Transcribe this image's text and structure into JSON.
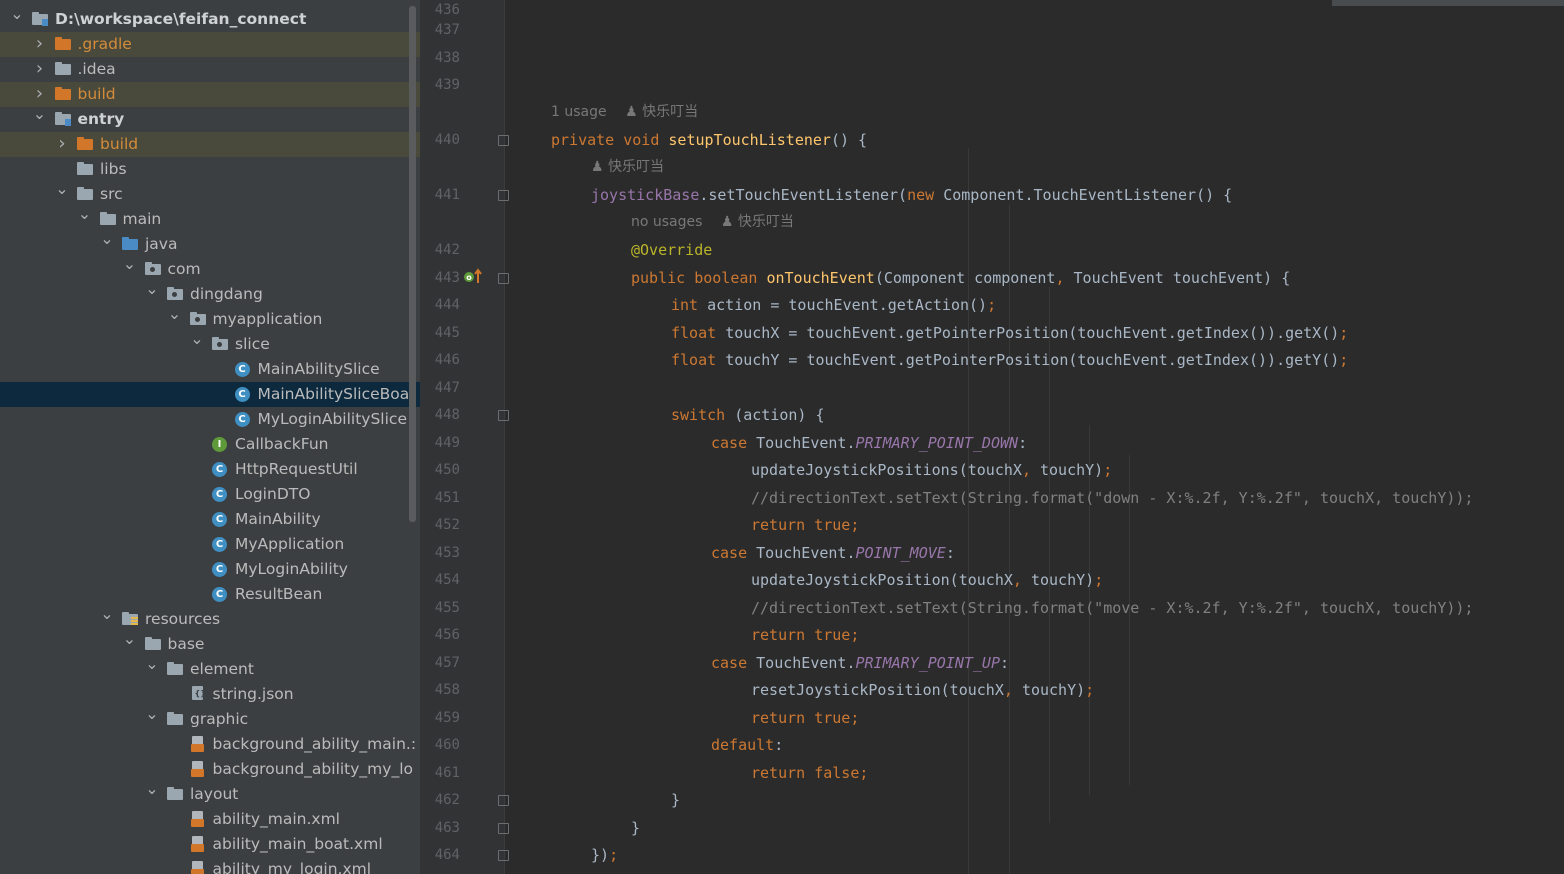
{
  "project_tree": [
    {
      "depth": 0,
      "arrow": "down",
      "icon": "module-folder",
      "label": "D:\\workspace\\feifan_connect",
      "style": "bold"
    },
    {
      "depth": 1,
      "arrow": "right",
      "icon": "orange-folder",
      "label": ".gradle",
      "style": "excluded"
    },
    {
      "depth": 1,
      "arrow": "right",
      "icon": "gray-folder",
      "label": ".idea",
      "style": "normal"
    },
    {
      "depth": 1,
      "arrow": "right",
      "icon": "orange-folder",
      "label": "build",
      "style": "excluded"
    },
    {
      "depth": 1,
      "arrow": "down",
      "icon": "module-folder",
      "label": "entry",
      "style": "bold"
    },
    {
      "depth": 2,
      "arrow": "right",
      "icon": "orange-folder",
      "label": "build",
      "style": "excluded"
    },
    {
      "depth": 2,
      "arrow": "none",
      "icon": "gray-folder",
      "label": "libs",
      "style": "normal"
    },
    {
      "depth": 2,
      "arrow": "down",
      "icon": "gray-folder",
      "label": "src",
      "style": "normal"
    },
    {
      "depth": 3,
      "arrow": "down",
      "icon": "gray-folder",
      "label": "main",
      "style": "normal"
    },
    {
      "depth": 4,
      "arrow": "down",
      "icon": "blue-folder",
      "label": "java",
      "style": "normal"
    },
    {
      "depth": 5,
      "arrow": "down",
      "icon": "package-folder",
      "label": "com",
      "style": "normal"
    },
    {
      "depth": 6,
      "arrow": "down",
      "icon": "package-folder",
      "label": "dingdang",
      "style": "normal"
    },
    {
      "depth": 7,
      "arrow": "down",
      "icon": "package-folder",
      "label": "myapplication",
      "style": "normal"
    },
    {
      "depth": 8,
      "arrow": "down",
      "icon": "package-folder",
      "label": "slice",
      "style": "normal"
    },
    {
      "depth": 9,
      "arrow": "none",
      "icon": "class",
      "label": "MainAbilitySlice",
      "style": "normal"
    },
    {
      "depth": 9,
      "arrow": "none",
      "icon": "class",
      "label": "MainAbilitySliceBoa",
      "style": "selected"
    },
    {
      "depth": 9,
      "arrow": "none",
      "icon": "class",
      "label": "MyLoginAbilitySlice",
      "style": "normal"
    },
    {
      "depth": 8,
      "arrow": "none",
      "icon": "interface",
      "label": "CallbackFun",
      "style": "normal"
    },
    {
      "depth": 8,
      "arrow": "none",
      "icon": "class",
      "label": "HttpRequestUtil",
      "style": "normal"
    },
    {
      "depth": 8,
      "arrow": "none",
      "icon": "class",
      "label": "LoginDTO",
      "style": "normal"
    },
    {
      "depth": 8,
      "arrow": "none",
      "icon": "class",
      "label": "MainAbility",
      "style": "normal"
    },
    {
      "depth": 8,
      "arrow": "none",
      "icon": "class",
      "label": "MyApplication",
      "style": "normal"
    },
    {
      "depth": 8,
      "arrow": "none",
      "icon": "class",
      "label": "MyLoginAbility",
      "style": "normal"
    },
    {
      "depth": 8,
      "arrow": "none",
      "icon": "class",
      "label": "ResultBean",
      "style": "normal"
    },
    {
      "depth": 4,
      "arrow": "down",
      "icon": "resources-folder",
      "label": "resources",
      "style": "normal"
    },
    {
      "depth": 5,
      "arrow": "down",
      "icon": "gray-folder",
      "label": "base",
      "style": "normal"
    },
    {
      "depth": 6,
      "arrow": "down",
      "icon": "gray-folder",
      "label": "element",
      "style": "normal"
    },
    {
      "depth": 7,
      "arrow": "none",
      "icon": "json-file",
      "label": "string.json",
      "style": "normal"
    },
    {
      "depth": 6,
      "arrow": "down",
      "icon": "gray-folder",
      "label": "graphic",
      "style": "normal"
    },
    {
      "depth": 7,
      "arrow": "none",
      "icon": "xml-file",
      "label": "background_ability_main.:",
      "style": "normal"
    },
    {
      "depth": 7,
      "arrow": "none",
      "icon": "xml-file",
      "label": "background_ability_my_lo",
      "style": "normal"
    },
    {
      "depth": 6,
      "arrow": "down",
      "icon": "gray-folder",
      "label": "layout",
      "style": "normal"
    },
    {
      "depth": 7,
      "arrow": "none",
      "icon": "xml-file",
      "label": "ability_main.xml",
      "style": "normal"
    },
    {
      "depth": 7,
      "arrow": "none",
      "icon": "xml-file",
      "label": "ability_main_boat.xml",
      "style": "normal"
    },
    {
      "depth": 7,
      "arrow": "none",
      "icon": "xml-file",
      "label": "ability_my_login.xml",
      "style": "normal"
    }
  ],
  "editor": {
    "hints": {
      "method_usage": "1 usage",
      "method_author": "快乐叮当",
      "listener_author": "快乐叮当",
      "override_usage": "no usages",
      "override_author": "快乐叮当"
    },
    "lines": [
      {
        "no": "436",
        "tokens": []
      },
      {
        "no": "437",
        "tokens": []
      },
      {
        "no": "438",
        "tokens": []
      },
      {
        "no": "439",
        "tokens": []
      },
      {
        "no": "440",
        "tokens": [
          [
            "kw",
            "private void "
          ],
          [
            "fn",
            "setupTouchListener"
          ],
          [
            "",
            "() {"
          ]
        ]
      },
      {
        "no": "441",
        "tokens": [
          [
            "field",
            "joystickBase"
          ],
          [
            "",
            ".setTouchEventListener("
          ],
          [
            "kw",
            "new "
          ],
          [
            "",
            "Component.TouchEventListener() {"
          ]
        ]
      },
      {
        "no": "442",
        "tokens": [
          [
            "an",
            "@Override"
          ]
        ]
      },
      {
        "no": "443",
        "tokens": [
          [
            "kw",
            "public boolean "
          ],
          [
            "fn",
            "onTouchEvent"
          ],
          [
            "",
            "(Component component"
          ],
          [
            "kw",
            ", "
          ],
          [
            "",
            "TouchEvent touchEvent) {"
          ]
        ]
      },
      {
        "no": "444",
        "tokens": [
          [
            "kw",
            "int "
          ],
          [
            "",
            "action = touchEvent.getAction()"
          ],
          [
            "kw",
            ";"
          ]
        ]
      },
      {
        "no": "445",
        "tokens": [
          [
            "kw",
            "float "
          ],
          [
            "",
            "touchX = touchEvent.getPointerPosition(touchEvent.getIndex()).getX()"
          ],
          [
            "kw",
            ";"
          ]
        ]
      },
      {
        "no": "446",
        "tokens": [
          [
            "kw",
            "float "
          ],
          [
            "",
            "touchY = touchEvent.getPointerPosition(touchEvent.getIndex()).getY()"
          ],
          [
            "kw",
            ";"
          ]
        ]
      },
      {
        "no": "447",
        "tokens": []
      },
      {
        "no": "448",
        "tokens": [
          [
            "kw",
            "switch "
          ],
          [
            "",
            "(action) {"
          ]
        ]
      },
      {
        "no": "449",
        "tokens": [
          [
            "kw",
            "case "
          ],
          [
            "",
            "TouchEvent."
          ],
          [
            "cst",
            "PRIMARY_POINT_DOWN"
          ],
          [
            "",
            ":"
          ]
        ]
      },
      {
        "no": "450",
        "tokens": [
          [
            "",
            "updateJoystickPositions(touchX"
          ],
          [
            "kw",
            ", "
          ],
          [
            "",
            "touchY)"
          ],
          [
            "kw",
            ";"
          ]
        ]
      },
      {
        "no": "451",
        "tokens": [
          [
            "cm",
            "//directionText.setText(String.format(\"down - X:%.2f, Y:%.2f\", touchX, touchY));"
          ]
        ]
      },
      {
        "no": "452",
        "tokens": [
          [
            "kw",
            "return true;"
          ]
        ]
      },
      {
        "no": "453",
        "tokens": [
          [
            "kw",
            "case "
          ],
          [
            "",
            "TouchEvent."
          ],
          [
            "cst",
            "POINT_MOVE"
          ],
          [
            "",
            ":"
          ]
        ]
      },
      {
        "no": "454",
        "tokens": [
          [
            "",
            "updateJoystickPosition(touchX"
          ],
          [
            "kw",
            ", "
          ],
          [
            "",
            "touchY)"
          ],
          [
            "kw",
            ";"
          ]
        ]
      },
      {
        "no": "455",
        "tokens": [
          [
            "cm",
            "//directionText.setText(String.format(\"move - X:%.2f, Y:%.2f\", touchX, touchY));"
          ]
        ]
      },
      {
        "no": "456",
        "tokens": [
          [
            "kw",
            "return true;"
          ]
        ]
      },
      {
        "no": "457",
        "tokens": [
          [
            "kw",
            "case "
          ],
          [
            "",
            "TouchEvent."
          ],
          [
            "cst",
            "PRIMARY_POINT_UP"
          ],
          [
            "",
            ":"
          ]
        ]
      },
      {
        "no": "458",
        "tokens": [
          [
            "",
            "resetJoystickPosition(touchX"
          ],
          [
            "kw",
            ", "
          ],
          [
            "",
            "touchY)"
          ],
          [
            "kw",
            ";"
          ]
        ]
      },
      {
        "no": "459",
        "tokens": [
          [
            "kw",
            "return true;"
          ]
        ]
      },
      {
        "no": "460",
        "tokens": [
          [
            "kw",
            "default"
          ],
          [
            "",
            ":"
          ]
        ]
      },
      {
        "no": "461",
        "tokens": [
          [
            "kw",
            "return false;"
          ]
        ]
      },
      {
        "no": "462",
        "tokens": [
          [
            "",
            "}"
          ]
        ]
      },
      {
        "no": "463",
        "tokens": [
          [
            "",
            "}"
          ]
        ]
      },
      {
        "no": "464",
        "tokens": [
          [
            "",
            "})"
          ],
          [
            "kw",
            ";"
          ]
        ]
      }
    ]
  },
  "colors": {
    "keyword": "#cc7832",
    "method": "#ffc66d",
    "comment": "#808080",
    "annotation": "#bbb529",
    "constant": "#9876aa",
    "text": "#a9b7c6",
    "excluded_folder": "#d48c3a",
    "selection": "#0d293e"
  }
}
